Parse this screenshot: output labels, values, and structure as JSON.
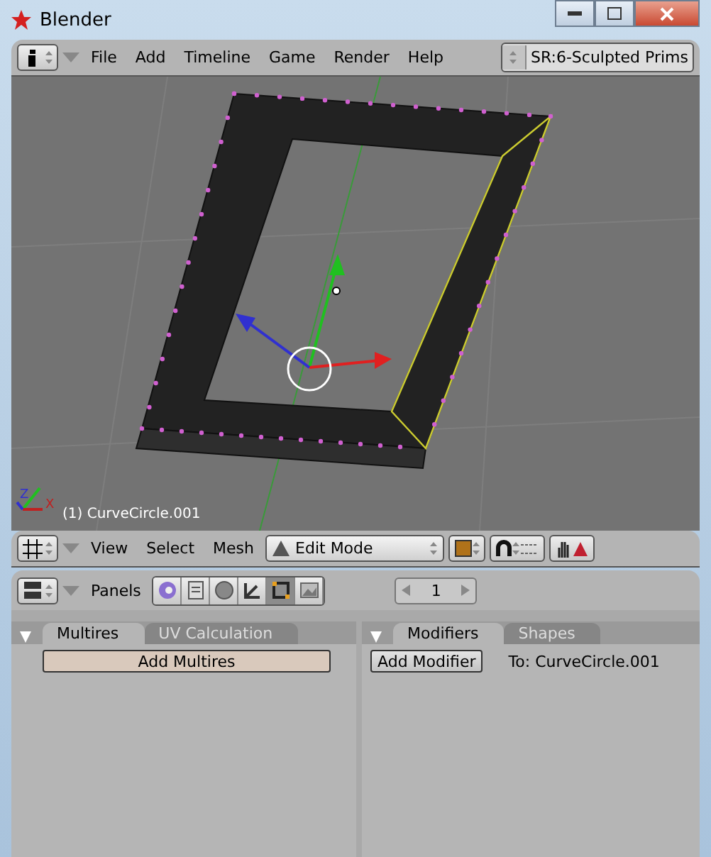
{
  "window": {
    "title": "Blender"
  },
  "top_header": {
    "menus": [
      "File",
      "Add",
      "Timeline",
      "Game",
      "Render",
      "Help"
    ],
    "screen": "SR:6-Sculpted Prims"
  },
  "viewport": {
    "object_label": "(1) CurveCircle.001",
    "axis_labels": [
      "Z",
      "X"
    ]
  },
  "view_header": {
    "menus": [
      "View",
      "Select",
      "Mesh"
    ],
    "mode": "Edit Mode"
  },
  "buttons_header": {
    "label": "Panels",
    "tools": [
      {
        "kind": "logic",
        "selected": false
      },
      {
        "kind": "script",
        "selected": false
      },
      {
        "kind": "shading",
        "selected": false
      },
      {
        "kind": "object",
        "selected": false
      },
      {
        "kind": "editing",
        "selected": true
      },
      {
        "kind": "scene",
        "selected": false
      }
    ],
    "frame": "1"
  },
  "panels": [
    {
      "tabs": [
        {
          "label": "Multires",
          "selected": true
        },
        {
          "label": "UV Calculation",
          "selected": false
        }
      ],
      "button": "Add Multires",
      "wide": true
    },
    {
      "tabs": [
        {
          "label": "Modifiers",
          "selected": true
        },
        {
          "label": "Shapes",
          "selected": false
        }
      ],
      "button": "Add Modifier",
      "wide": false,
      "note": "To: CurveCircle.001"
    }
  ]
}
